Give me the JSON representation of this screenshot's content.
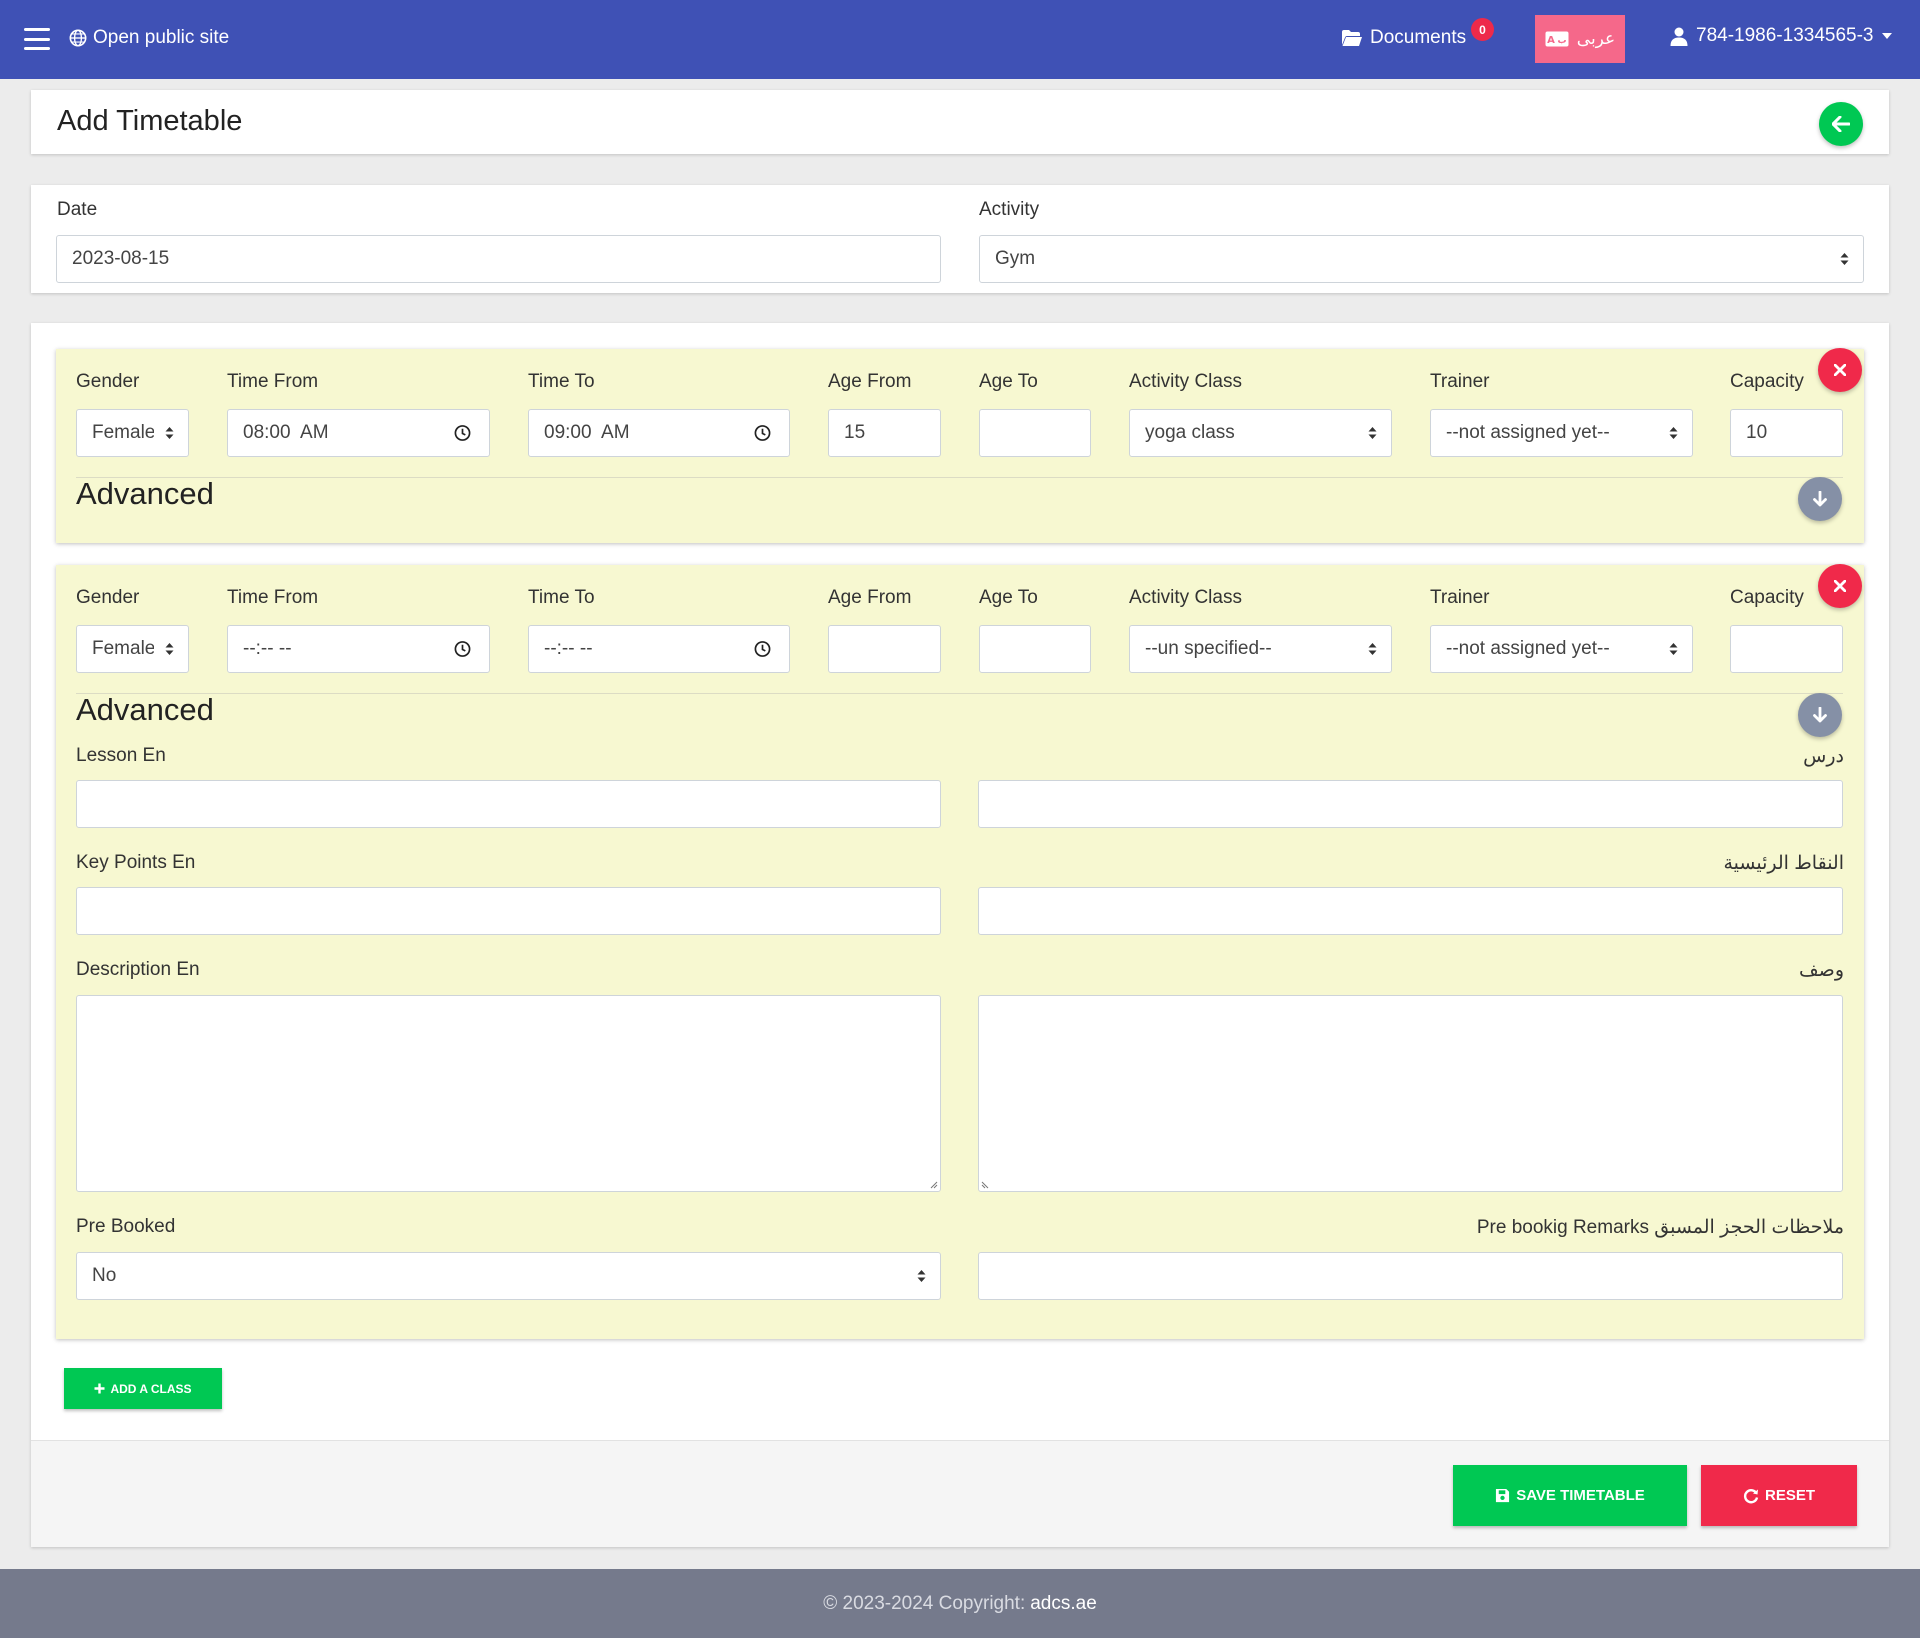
{
  "navbar": {
    "open_public_site": "Open public site",
    "documents_label": "Documents",
    "documents_count": "0",
    "language_label": "عربى",
    "user_id": "784-1986-1334565-3"
  },
  "header": {
    "title": "Add Timetable"
  },
  "top_form": {
    "date_label": "Date",
    "date_value": "2023-08-15",
    "activity_label": "Activity",
    "activity_value": "Gym"
  },
  "class_labels": {
    "gender": "Gender",
    "time_from": "Time From",
    "time_to": "Time To",
    "age_from": "Age From",
    "age_to": "Age To",
    "activity_class": "Activity Class",
    "trainer": "Trainer",
    "capacity": "Capacity",
    "advanced": "Advanced"
  },
  "classes": [
    {
      "gender": "Female",
      "time_from": "08:00  AM",
      "time_to": "09:00  AM",
      "age_from": "15",
      "age_to": "",
      "activity_class": "yoga class",
      "trainer": "--not assigned yet--",
      "capacity": "10"
    },
    {
      "gender": "Female",
      "time_from": "--:-- --",
      "time_to": "--:-- --",
      "age_from": "",
      "age_to": "",
      "activity_class": "--un specified--",
      "trainer": "--not assigned yet--",
      "capacity": ""
    }
  ],
  "advanced": {
    "lesson_en_label": "Lesson En",
    "lesson_ar_label": "درس",
    "key_points_en_label": "Key Points En",
    "key_points_ar_label": "النقاط الرئيسية",
    "description_en_label": "Description En",
    "description_ar_label": "وصف",
    "pre_booked_label": "Pre Booked",
    "pre_booked_value": "No",
    "pre_booking_remarks_label": "Pre bookig Remarks ملاحظات الحجز المسبق"
  },
  "actions": {
    "add_class": "ADD A CLASS",
    "save_timetable": "SAVE TIMETABLE",
    "reset": "RESET"
  },
  "footer": {
    "copyright": "© 2023-2024 Copyright:",
    "site": "adcs.ae"
  },
  "colors": {
    "navbar": "#3f51b5",
    "success": "#00c853",
    "danger": "#f0294a",
    "class_bg": "#f7f8d1",
    "language_button": "#f5688a",
    "footer": "#757a8c"
  }
}
